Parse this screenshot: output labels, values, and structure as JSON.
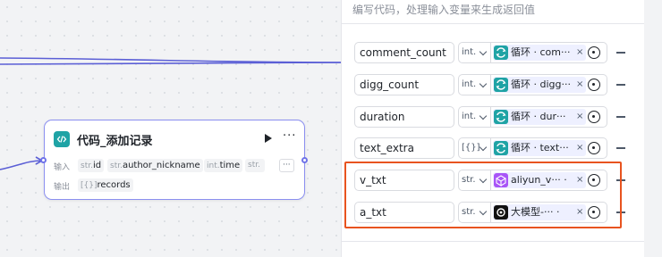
{
  "node": {
    "title": "代码_添加记录",
    "input_label": "输入",
    "output_label": "输出",
    "inputs": [
      {
        "type": "str.",
        "name": "id"
      },
      {
        "type": "str.",
        "name": "author_nickname"
      },
      {
        "type": "int.",
        "name": "time"
      },
      {
        "type": "str.",
        "name": ""
      }
    ],
    "more_inputs": "···",
    "output": {
      "type": "[{}]",
      "name": "records"
    },
    "run_icon": "play-icon",
    "menu_icon": "more-icon",
    "icon": "code-icon"
  },
  "panel": {
    "description": "编写代码，处理输入变量来生成返回值",
    "rows": [
      {
        "name": "comment_count",
        "type": "int.",
        "ref_icon": "loop-icon",
        "ref": "循环 · com···",
        "highlight": false
      },
      {
        "name": "digg_count",
        "type": "int.",
        "ref_icon": "loop-icon",
        "ref": "循环 · digg···",
        "highlight": false
      },
      {
        "name": "duration",
        "type": "int.",
        "ref_icon": "loop-icon",
        "ref": "循环 · dur···",
        "highlight": false
      },
      {
        "name": "text_extra",
        "type": "[{}]",
        "ref_icon": "loop-icon",
        "ref": "循环 · text···",
        "highlight": false
      },
      {
        "name": "v_txt",
        "type": "str.",
        "ref_icon": "plugin-icon",
        "ref": "aliyun_v··· ·",
        "highlight": true
      },
      {
        "name": "a_txt",
        "type": "str.",
        "ref_icon": "model-icon",
        "ref": "大模型-··· ·",
        "highlight": true
      }
    ],
    "clear_symbol": "×",
    "colors": {
      "loop": "#1fa3a5",
      "plugin": "#a855f7",
      "model": "#111111",
      "highlight": "#e8531f",
      "edge": "#5b5fd6"
    }
  }
}
